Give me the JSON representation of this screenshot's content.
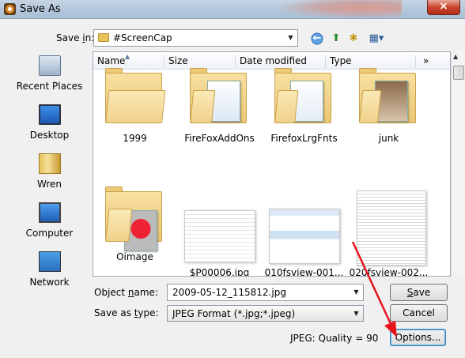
{
  "window": {
    "title": "Save As",
    "close": "×"
  },
  "save_in": {
    "label_pre": "Save ",
    "label_key": "i",
    "label_post": "n:",
    "value": "#ScreenCap"
  },
  "places": [
    {
      "label": "Recent Places",
      "icon": "recent-places-icon"
    },
    {
      "label": "Desktop",
      "icon": "desktop-icon"
    },
    {
      "label": "Wren",
      "icon": "user-folder-icon"
    },
    {
      "label": "Computer",
      "icon": "computer-icon"
    },
    {
      "label": "Network",
      "icon": "network-icon"
    }
  ],
  "columns": [
    "Name",
    "Size",
    "Date modified",
    "Type",
    "»"
  ],
  "items_row1": [
    "1999",
    "FireFoxAddOns",
    "FirefoxLrgFnts",
    "junk"
  ],
  "items_row2": [
    "Oimage",
    "$P00006.jpg",
    "010fsview-001...",
    "020fsview-002..."
  ],
  "object_name": {
    "label_pre": "Object ",
    "label_key": "n",
    "label_post": "ame:",
    "value": "2009-05-12_115812.jpg"
  },
  "save_as_type": {
    "label_pre": "Save as ",
    "label_key": "t",
    "label_post": "ype:",
    "value": "JPEG Format (*.jpg;*.jpeg)"
  },
  "buttons": {
    "save_key": "S",
    "save_rest": "ave",
    "cancel": "Cancel",
    "options": "Options..."
  },
  "quality": "JPEG: Quality = 90",
  "colors": {
    "annotation_arrow": "#e8141c"
  }
}
